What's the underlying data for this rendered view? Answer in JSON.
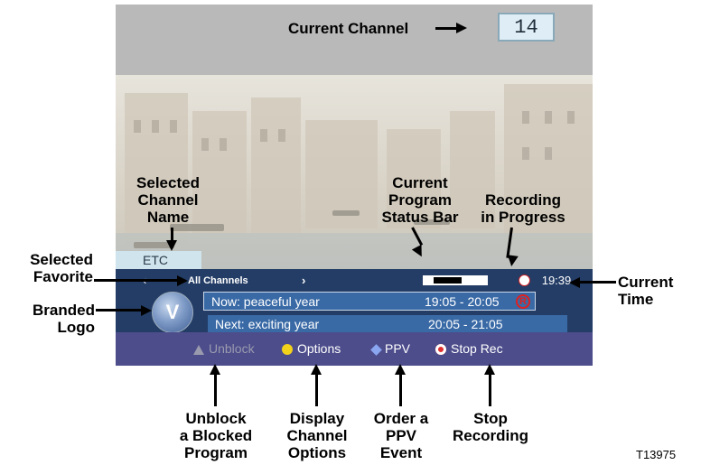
{
  "screen": {
    "channel_number": "14",
    "etc_tab": "ETC",
    "favorite": {
      "label": "All Channels",
      "left_arrow": "‹",
      "right_arrow": "›"
    },
    "program_progress": 0.55,
    "current_time": "19:39",
    "logo_glyph": "V",
    "now": {
      "title": "Now: peaceful year",
      "time": "19:05 - 20:05",
      "rec_mark": "R"
    },
    "next": {
      "title": "Next: exciting year",
      "time": "20:05 - 21:05"
    },
    "footer_buttons": [
      {
        "label": "Unblock",
        "icon": "gray-triangle-icon"
      },
      {
        "label": "Options",
        "icon": "yellow-circle-icon"
      },
      {
        "label": "PPV",
        "icon": "blue-diamond-icon"
      },
      {
        "label": "Stop Rec",
        "icon": "red-record-icon"
      }
    ]
  },
  "callouts": {
    "current_channel": "Current Channel",
    "selected_channel_name": [
      "Selected",
      "Channel",
      "Name"
    ],
    "current_program_status_bar": [
      "Current",
      "Program",
      "Status Bar"
    ],
    "recording_in_progress": [
      "Recording",
      "in Progress"
    ],
    "selected_favorite": [
      "Selected",
      "Favorite"
    ],
    "current_time": [
      "Current",
      "Time"
    ],
    "branded_logo": [
      "Branded",
      "Logo"
    ],
    "unblock": [
      "Unblock",
      "a Blocked",
      "Program"
    ],
    "display_options": [
      "Display",
      "Channel",
      "Options"
    ],
    "order_ppv": [
      "Order a",
      "PPV",
      "Event"
    ],
    "stop_recording": [
      "Stop",
      "Recording"
    ]
  },
  "figure_id": "T13975",
  "colors": {
    "guide_bg": "#243d66",
    "program_row": "#3a6aa6",
    "footer_bg": "#4d4d8c",
    "top_bar": "#b9b9b9"
  }
}
